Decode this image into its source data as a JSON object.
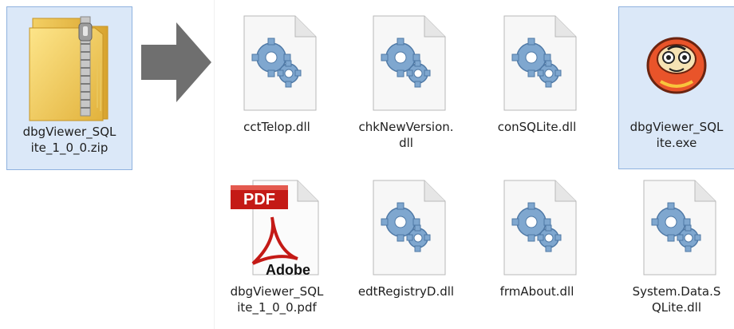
{
  "source": {
    "file": "dbgViewer_SQLite_1_0_0.zip"
  },
  "files": [
    {
      "name": "cctTelop.dll",
      "icon": "dll-gear-icon"
    },
    {
      "name": "chkNewVersion.dll",
      "icon": "dll-gear-icon"
    },
    {
      "name": "conSQLite.dll",
      "icon": "dll-gear-icon"
    },
    {
      "name": "dbgViewer_SQLite.exe",
      "icon": "daruma-exe-icon",
      "selected": true
    },
    {
      "name": "dbgViewer_SQLite_1_0_0.pdf",
      "icon": "pdf-adobe-icon"
    },
    {
      "name": "edtRegistryD.dll",
      "icon": "dll-gear-icon"
    },
    {
      "name": "frmAbout.dll",
      "icon": "dll-gear-icon"
    },
    {
      "name": "System.Data.SQLite.dll",
      "icon": "dll-gear-icon"
    }
  ],
  "labels": {
    "zip": [
      "dbgViewer_SQL",
      "ite_1_0_0.zip"
    ],
    "f1": [
      "cctTelop.dll"
    ],
    "f2": [
      "chkNewVersion.",
      "dll"
    ],
    "f3": [
      "conSQLite.dll"
    ],
    "f4": [
      "dbgViewer_SQL",
      "ite.exe"
    ],
    "f5": [
      "dbgViewer_SQL",
      "ite_1_0_0.pdf"
    ],
    "f6": [
      "edtRegistryD.dll"
    ],
    "f7": [
      "frmAbout.dll"
    ],
    "f8": [
      "System.Data.S",
      "QLite.dll"
    ]
  },
  "pdf_badge": "PDF",
  "adobe_text": "Adobe",
  "colors": {
    "selection": "#dbe8f8",
    "selection_border": "#8fb2df",
    "arrow": "#6f6f6f",
    "pdf_red": "#c41a16"
  }
}
